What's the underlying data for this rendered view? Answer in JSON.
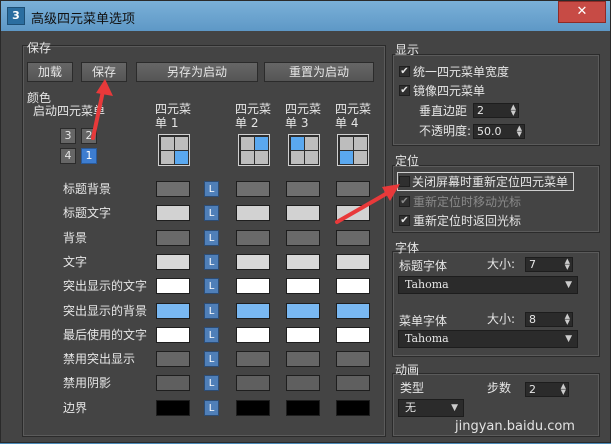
{
  "window": {
    "title": "高级四元菜单选项",
    "app_icon": "3",
    "close_glyph": "✕"
  },
  "save_group": {
    "label": "保存",
    "load": "加载",
    "save": "保存",
    "save_as_startup": "另存为启动",
    "reset_to_startup": "重置为启动"
  },
  "colors_group": {
    "label": "颜色",
    "startup_quad_label": "启动四元菜单",
    "quad_buttons": [
      "3",
      "2",
      "4",
      "1"
    ],
    "columns": [
      "四元菜单 1",
      "四元菜单 2",
      "四元菜单 3",
      "四元菜单 4"
    ],
    "l_label": "L",
    "rows": [
      {
        "label": "标题背景",
        "colors": [
          "#6f6f6f",
          "#6f6f6f",
          "#6f6f6f",
          "#6f6f6f"
        ]
      },
      {
        "label": "标题文字",
        "colors": [
          "#d2d2d2",
          "#d2d2d2",
          "#d2d2d2",
          "#d2d2d2"
        ]
      },
      {
        "label": "背景",
        "colors": [
          "#6a6a6a",
          "#6a6a6a",
          "#6a6a6a",
          "#6a6a6a"
        ]
      },
      {
        "label": "文字",
        "colors": [
          "#d8d8d8",
          "#d8d8d8",
          "#d8d8d8",
          "#d8d8d8"
        ]
      },
      {
        "label": "突出显示的文字",
        "colors": [
          "#ffffff",
          "#ffffff",
          "#ffffff",
          "#ffffff"
        ]
      },
      {
        "label": "突出显示的背景",
        "colors": [
          "#79b8f2",
          "#79b8f2",
          "#79b8f2",
          "#79b8f2"
        ]
      },
      {
        "label": "最后使用的文字",
        "colors": [
          "#ffffff",
          "#ffffff",
          "#ffffff",
          "#ffffff"
        ]
      },
      {
        "label": "禁用突出显示",
        "colors": [
          "#666666",
          "#666666",
          "#666666",
          "#666666"
        ]
      },
      {
        "label": "禁用阴影",
        "colors": [
          "#5f5f5f",
          "#5f5f5f",
          "#5f5f5f",
          "#5f5f5f"
        ]
      },
      {
        "label": "边界",
        "colors": [
          "#000000",
          "#000000",
          "#000000",
          "#000000"
        ]
      }
    ]
  },
  "display_group": {
    "label": "显示",
    "uniform_width": "统一四元菜单宽度",
    "mirror": "镜像四元菜单",
    "vertical_margin_label": "垂直边距",
    "vertical_margin": "2",
    "opacity_label": "不透明度:",
    "opacity": "50.0"
  },
  "position_group": {
    "label": "定位",
    "reposition_on_close": "关闭屏幕时重新定位四元菜单",
    "reposition_move_cursor": "重新定位时移动光标",
    "reposition_return_cursor": "重新定位时返回光标"
  },
  "font_group": {
    "label": "字体",
    "title_font_label": "标题字体",
    "title_size_label": "大小:",
    "title_size": "7",
    "title_font": "Tahoma",
    "menu_font_label": "菜单字体",
    "menu_size_label": "大小:",
    "menu_size": "8",
    "menu_font": "Tahoma"
  },
  "animation_group": {
    "label": "动画",
    "type_label": "类型",
    "type_value": "无",
    "steps_label": "步数",
    "steps": "2"
  },
  "watermark": "jingyan.baidu.com"
}
